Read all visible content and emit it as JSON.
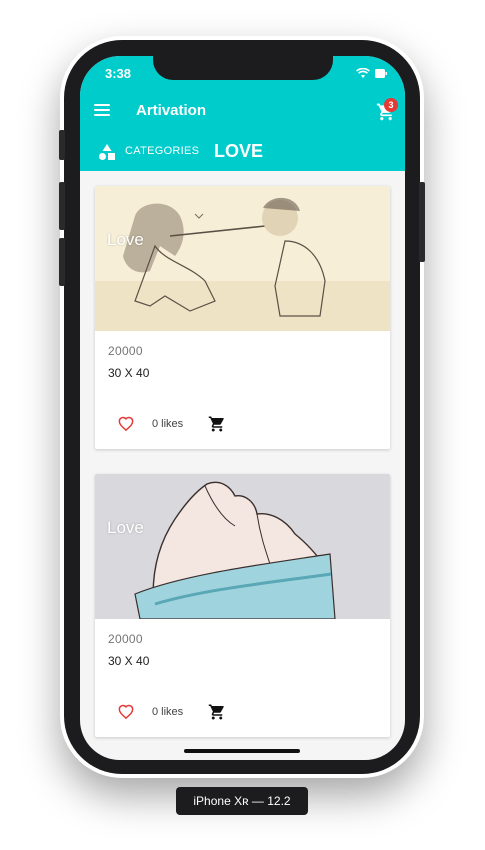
{
  "status_bar": {
    "time": "3:38"
  },
  "app_bar": {
    "title": "Artivation",
    "cart_count": "3"
  },
  "category_bar": {
    "label": "CATEGORIES",
    "current": "LOVE"
  },
  "cards": [
    {
      "image_label": "Love",
      "price": "20000",
      "size": "30 X 40",
      "likes": "0 likes"
    },
    {
      "image_label": "Love",
      "price": "20000",
      "size": "30 X 40",
      "likes": "0 likes"
    }
  ],
  "device_label": "iPhone Xʀ — 12.2",
  "colors": {
    "primary": "#00CCCC",
    "heart": "#e53935",
    "badge": "#e53935"
  }
}
